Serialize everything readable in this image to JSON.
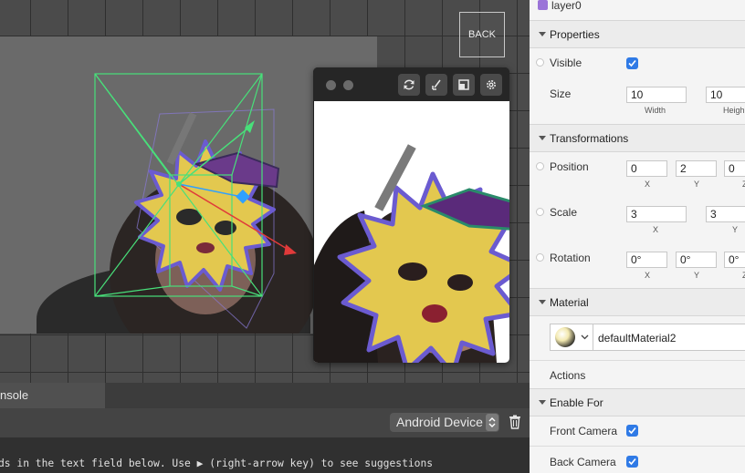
{
  "viewport": {
    "back_label": "BACK"
  },
  "preview": {
    "buttons": [
      "refresh-icon",
      "pen-icon",
      "layout-icon",
      "gear-icon"
    ]
  },
  "console": {
    "tab_label": "nsole",
    "device_select": "Android Device",
    "hint": "ds in the text field below. Use ▶ (right-arrow key) to see suggestions"
  },
  "inspector": {
    "layer_name": "layer0",
    "layer_color": "#9b74d8",
    "properties": {
      "title": "Properties",
      "visible_label": "Visible",
      "visible": true,
      "size_label": "Size",
      "width": "10",
      "height": "10",
      "width_label": "Width",
      "height_label": "Heigh"
    },
    "transformations": {
      "title": "Transformations",
      "position_label": "Position",
      "position": [
        "0",
        "2",
        "0"
      ],
      "scale_label": "Scale",
      "scale": [
        "3",
        "3"
      ],
      "rotation_label": "Rotation",
      "rotation": [
        "0°",
        "0°",
        "0°"
      ],
      "axis_x": "X",
      "axis_y": "Y",
      "axis_z": "Z"
    },
    "material": {
      "title": "Material",
      "name": "defaultMaterial2"
    },
    "actions": {
      "title": "Actions"
    },
    "enable_for": {
      "title": "Enable For",
      "front_label": "Front Camera",
      "front": true,
      "back_label": "Back Camera",
      "back": true
    }
  },
  "colors": {
    "accent": "#2f7ae6",
    "gizmo_green": "#48e07a",
    "gizmo_blue": "#2fa0ff",
    "gizmo_red": "#e03a3a",
    "mask_yellow": "#e3c84f",
    "mask_outline": "#6b5bd0"
  }
}
